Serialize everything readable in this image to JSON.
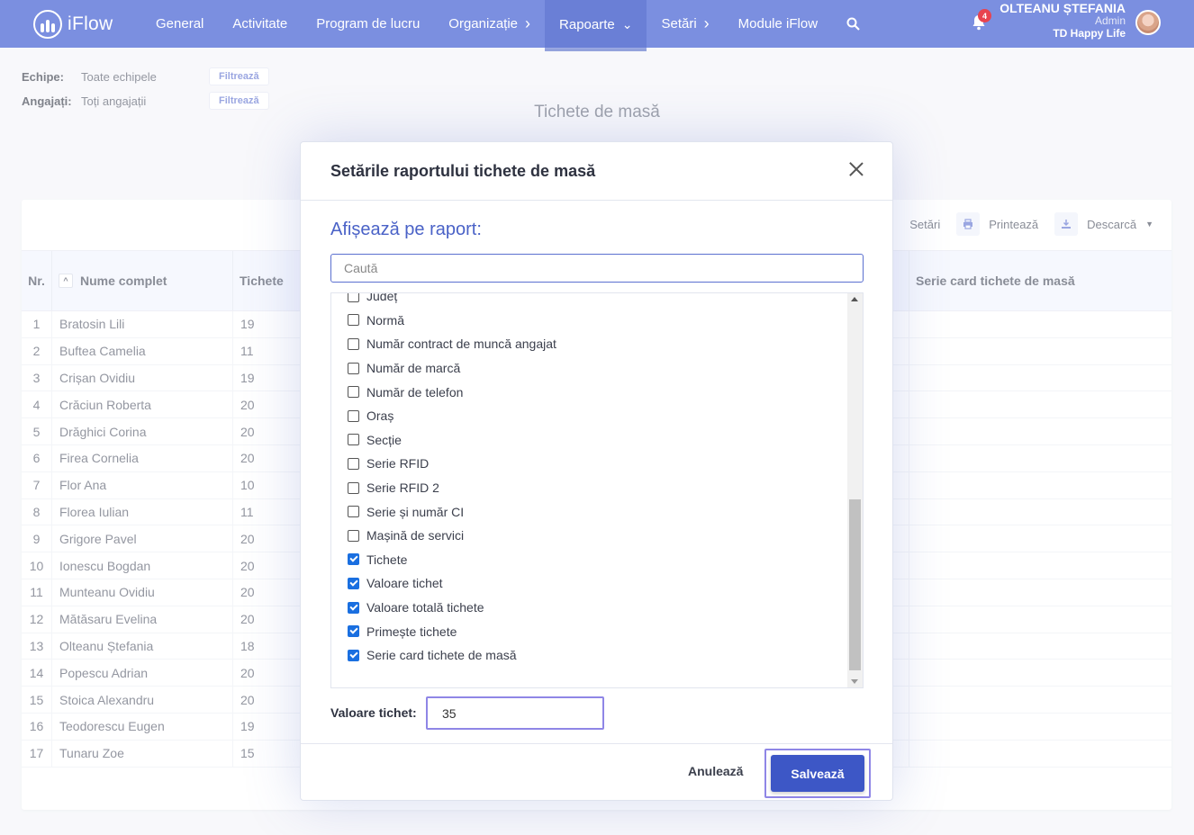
{
  "app": {
    "name": "iFlow"
  },
  "nav": {
    "items": [
      {
        "label": "General",
        "has_chevron": false
      },
      {
        "label": "Activitate",
        "has_chevron": false
      },
      {
        "label": "Program de lucru",
        "has_chevron": false
      },
      {
        "label": "Organizație",
        "has_chevron": true
      },
      {
        "label": "Rapoarte",
        "has_chevron": true,
        "active": true
      },
      {
        "label": "Setări",
        "has_chevron": true
      },
      {
        "label": "Module iFlow",
        "has_chevron": false
      }
    ],
    "search_icon": "search-icon",
    "notifications_count": "4"
  },
  "user": {
    "name": "OLTEANU ȘTEFANIA",
    "role": "Admin",
    "company": "TD Happy Life"
  },
  "filters": {
    "teams_label": "Echipe:",
    "teams_value": "Toate echipele",
    "teams_button": "Filtrează",
    "employees_label": "Angajați:",
    "employees_value": "Toți angajații",
    "employees_button": "Filtrează"
  },
  "page_title": "Tichete de masă",
  "toolbar": {
    "settings": "Setări",
    "print": "Printează",
    "download": "Descarcă"
  },
  "table": {
    "headers": {
      "nr": "Nr.",
      "name": "Nume complet",
      "tickets": "Tichete",
      "serie": "Serie card tichete de masă"
    },
    "rows": [
      {
        "nr": "1",
        "name": "Bratosin Lili",
        "tickets": "19"
      },
      {
        "nr": "2",
        "name": "Buftea Camelia",
        "tickets": "11"
      },
      {
        "nr": "3",
        "name": "Crișan Ovidiu",
        "tickets": "19"
      },
      {
        "nr": "4",
        "name": "Crăciun Roberta",
        "tickets": "20"
      },
      {
        "nr": "5",
        "name": "Drăghici Corina",
        "tickets": "20"
      },
      {
        "nr": "6",
        "name": "Firea Cornelia",
        "tickets": "20"
      },
      {
        "nr": "7",
        "name": "Flor Ana",
        "tickets": "10"
      },
      {
        "nr": "8",
        "name": "Florea Iulian",
        "tickets": "11"
      },
      {
        "nr": "9",
        "name": "Grigore Pavel",
        "tickets": "20"
      },
      {
        "nr": "10",
        "name": "Ionescu Bogdan",
        "tickets": "20"
      },
      {
        "nr": "11",
        "name": "Munteanu Ovidiu",
        "tickets": "20"
      },
      {
        "nr": "12",
        "name": "Mătăsaru Evelina",
        "tickets": "20"
      },
      {
        "nr": "13",
        "name": "Olteanu Ștefania",
        "tickets": "18"
      },
      {
        "nr": "14",
        "name": "Popescu Adrian",
        "tickets": "20"
      },
      {
        "nr": "15",
        "name": "Stoica Alexandru",
        "tickets": "20"
      },
      {
        "nr": "16",
        "name": "Teodorescu Eugen",
        "tickets": "19"
      },
      {
        "nr": "17",
        "name": "Tunaru Zoe",
        "tickets": "15"
      }
    ]
  },
  "modal": {
    "title": "Setările raportului tichete de masă",
    "section_title": "Afișează pe raport:",
    "search_placeholder": "Caută",
    "options": [
      {
        "label": "Județ",
        "checked": false
      },
      {
        "label": "Normă",
        "checked": false
      },
      {
        "label": "Număr contract de muncă angajat",
        "checked": false
      },
      {
        "label": "Număr de marcă",
        "checked": false
      },
      {
        "label": "Număr de telefon",
        "checked": false
      },
      {
        "label": "Oraș",
        "checked": false
      },
      {
        "label": "Secție",
        "checked": false
      },
      {
        "label": "Serie RFID",
        "checked": false
      },
      {
        "label": "Serie RFID 2",
        "checked": false
      },
      {
        "label": "Serie și număr CI",
        "checked": false
      },
      {
        "label": "Mașină de servici",
        "checked": false
      },
      {
        "label": "Tichete",
        "checked": true
      },
      {
        "label": "Valoare tichet",
        "checked": true
      },
      {
        "label": "Valoare totală tichete",
        "checked": true
      },
      {
        "label": "Primește tichete",
        "checked": true
      },
      {
        "label": "Serie card tichete de masă",
        "checked": true
      }
    ],
    "ticket_value_label": "Valoare tichet:",
    "ticket_value": "35",
    "cancel": "Anulează",
    "save": "Salvează"
  },
  "colors": {
    "nav_bg": "#7b8fe0",
    "accent": "#3d57c6",
    "highlight": "#8f86e6",
    "checkbox": "#1a6fe0"
  }
}
